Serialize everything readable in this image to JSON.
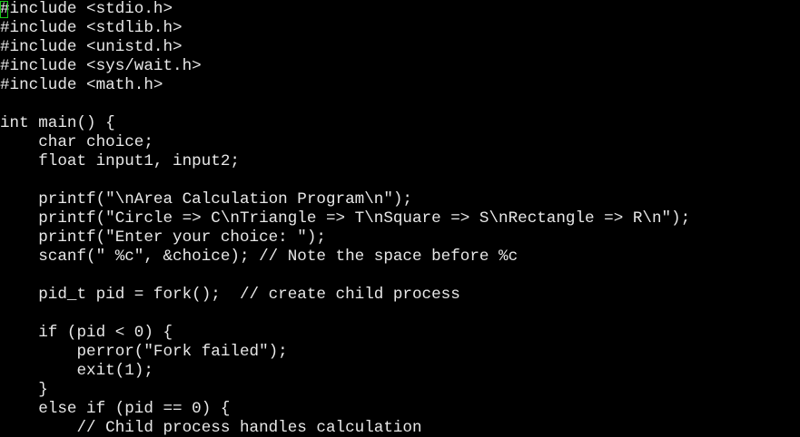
{
  "editor": {
    "lines": [
      "#include <stdio.h>",
      "#include <stdlib.h>",
      "#include <unistd.h>",
      "#include <sys/wait.h>",
      "#include <math.h>",
      "",
      "int main() {",
      "    char choice;",
      "    float input1, input2;",
      "",
      "    printf(\"\\nArea Calculation Program\\n\");",
      "    printf(\"Circle => C\\nTriangle => T\\nSquare => S\\nRectangle => R\\n\");",
      "    printf(\"Enter your choice: \");",
      "    scanf(\" %c\", &choice); // Note the space before %c",
      "",
      "    pid_t pid = fork();  // create child process",
      "",
      "    if (pid < 0) {",
      "        perror(\"Fork failed\");",
      "        exit(1);",
      "    }",
      "    else if (pid == 0) {",
      "        // Child process handles calculation"
    ],
    "text_color": "#e8e8e8",
    "background_color": "#000000",
    "cursor_color": "#19c919"
  }
}
